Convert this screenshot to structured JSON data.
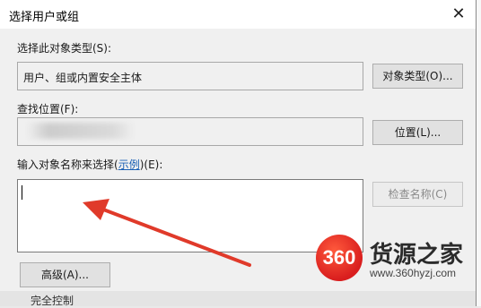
{
  "window": {
    "title": "选择用户或组",
    "close_glyph": "✕"
  },
  "object_type": {
    "label": "选择此对象类型(S):",
    "value": "用户、组或内置安全主体",
    "button": "对象类型(O)..."
  },
  "location": {
    "label": "查找位置(F):",
    "button": "位置(L)..."
  },
  "names": {
    "label_prefix": "输入对象名称来选择(",
    "label_link": "示例",
    "label_suffix": ")(E):",
    "check_button": "检查名称(C)"
  },
  "footer": {
    "advanced_button": "高级(A)..."
  },
  "background": {
    "partial_text": "完全控制"
  },
  "watermark": {
    "logo": "360",
    "brand": "货源之家",
    "url": "www.360hyzj.com"
  },
  "colors": {
    "arrow": "#e03a2a",
    "link": "#1a5fb4"
  }
}
